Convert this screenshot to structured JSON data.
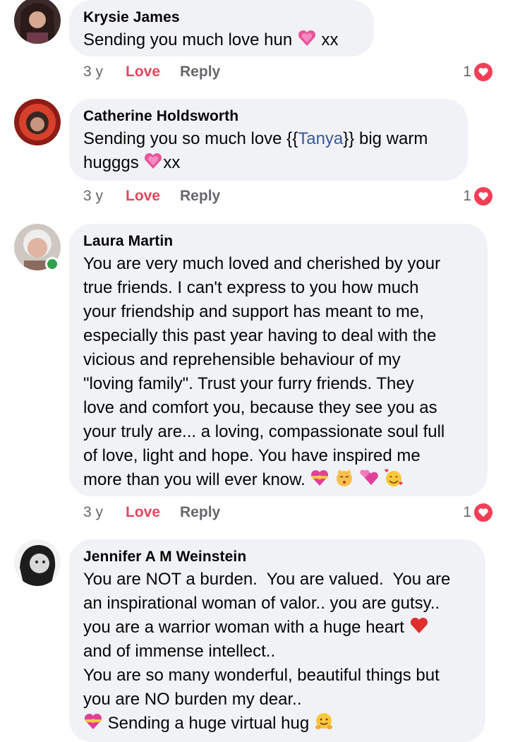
{
  "comments": [
    {
      "author": "Krysie James",
      "text_before": "Sending you much love hun ",
      "text_after": " xx",
      "time": "3 y",
      "love_label": "Love",
      "reply_label": "Reply",
      "reaction_count": "1",
      "reaction_icon": "heart-reaction-icon"
    },
    {
      "author": "Catherine Holdsworth",
      "text_part1": "Sending you so much love {{",
      "mention": "Tanya",
      "text_part2": "}} big warm",
      "text_part3": "hugggs ",
      "text_part4": "xx",
      "time": "3 y",
      "love_label": "Love",
      "reply_label": "Reply",
      "reaction_count": "1",
      "reaction_icon": "heart-reaction-icon"
    },
    {
      "author": "Laura Martin",
      "text": "You are very much loved and cherished by your\ntrue friends. I can't express to you how much\nyour friendship and support has meant to me,\nespecially this past year having to deal with the\nvicious and reprehensible behaviour of my\n\"loving family\". Trust your furry friends. They\nlove and comfort you, because they see you as\nyour truly are... a loving, compassionate soul full\nof love, light and hope. You have inspired me\nmore than you will ever know. ",
      "time": "3 y",
      "love_label": "Love",
      "reply_label": "Reply",
      "reaction_count": "1",
      "reaction_icon": "heart-reaction-icon",
      "online": true
    },
    {
      "author": "Jennifer A M Weinstein",
      "text_a": "You are NOT a burden.  You are valued.  You are\nan inspirational woman of valor.. you are gutsy..\nyou are a warrior woman with a huge heart ",
      "text_b": "\nand of immense intellect..\nYou are so many wonderful, beautiful things but\nyou are NO burden my dear..\n",
      "text_c": " Sending a huge virtual hug "
    }
  ],
  "colors": {
    "bubble_bg": "#f0f2f5",
    "love_text": "#e0495d",
    "meta_text": "#65676b",
    "mention": "#385898",
    "reaction_heart": "#f33e58",
    "online": "#31a24c"
  }
}
